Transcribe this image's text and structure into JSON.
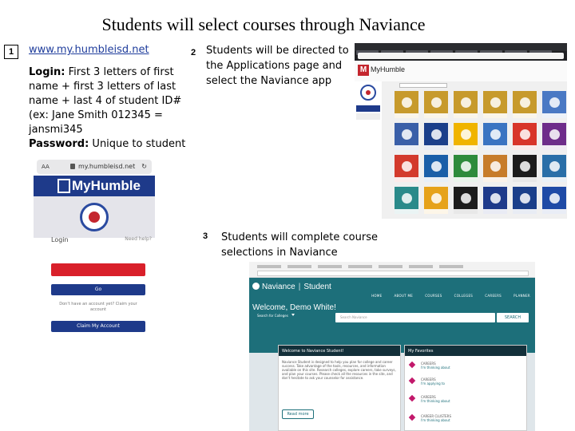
{
  "title": "Students will select courses through Naviance",
  "step1": {
    "number": "1",
    "url": "www.my.humbleisd.net",
    "login_label": "Login:",
    "login_text": " First 3 letters of first name + first 3 letters of last name + last 4 of student ID# (ex: Jane Smith 012345 = jansmi345",
    "password_label": "Password:",
    "password_text": " Unique to student"
  },
  "step2": {
    "number": "2",
    "text": "Students will be directed to the Applications page and select the Naviance app"
  },
  "step3": {
    "number": "3",
    "text": "Students will complete course selections in Naviance"
  },
  "phone_screenshot": {
    "aa": "AA",
    "address": "my.humbleisd.net",
    "logo": "MyHumble",
    "login": "Login",
    "need_help": "Need help?",
    "go": "Go",
    "no_account": "Don't have an account yet? Claim your account",
    "claim": "Claim My Account"
  },
  "portal_screenshot": {
    "brand": "MyHumble",
    "tile_colors": [
      "#c79a2c",
      "#c79a2c",
      "#c79a2c",
      "#c79a2c",
      "#c79a2c",
      "#4a79c4",
      "#3a5fa8",
      "#1b3f8a",
      "#f0b400",
      "#3a74c2",
      "#d8352a",
      "#6e2c8a",
      "#d33a2c",
      "#1b5fa8",
      "#2e8b3c",
      "#c77c2a",
      "#1c1c1c",
      "#2a6fa8",
      "#2a8a8a",
      "#e6a21a",
      "#1c1c1c",
      "#1e3a8a",
      "#1b3f8a",
      "#1e4aa6"
    ]
  },
  "naviance_screenshot": {
    "brand": "Naviance",
    "section": "Student",
    "menu": [
      "HOME",
      "ABOUT ME",
      "COURSES",
      "COLLEGES",
      "CAREERS",
      "PLANNER"
    ],
    "welcome": "Welcome, Demo White!",
    "search_scope": "Search for Colleges",
    "search_placeholder": "Search Naviance",
    "search_button": "SEARCH",
    "card1_title": "Welcome to Naviance Student!",
    "card1_body": "Naviance Student is designed to help you plan for college and career success. Take advantage of the tools, resources, and information available on this site. Research colleges, explore careers, take surveys, and plan your courses. Please check all the resources in the site, and don't hesitate to ask your counselor for assistance.",
    "read_more": "Read more",
    "card2_title": "My Favorites",
    "favorites": [
      {
        "name": "CAREERS",
        "link": "I'm thinking about"
      },
      {
        "name": "CAREERS",
        "link": "I'm applying to"
      },
      {
        "name": "CAREERS",
        "link": "I'm thinking about"
      },
      {
        "name": "CAREER CLUSTERS",
        "link": "I'm thinking about"
      }
    ]
  }
}
